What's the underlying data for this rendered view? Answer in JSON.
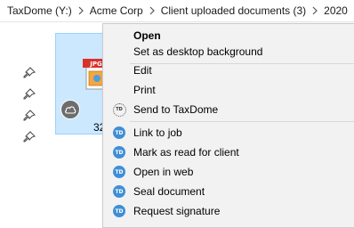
{
  "breadcrumb": {
    "items": [
      "TaxDome (Y:)",
      "Acme Corp",
      "Client uploaded documents (3)",
      "2020"
    ],
    "separator_icon": "chevron-right-icon"
  },
  "left_pane": {
    "pin_icons": [
      "pin-icon",
      "pin-icon",
      "pin-icon",
      "pin-icon"
    ]
  },
  "file": {
    "icon": "jpg-file-icon",
    "icon_label": "JPG",
    "status_icon": "cloud-icon",
    "name_visible": "32"
  },
  "context_menu": {
    "items": [
      {
        "label": "Open",
        "bold": true,
        "icon": ""
      },
      {
        "label": "Set as desktop background",
        "icon": ""
      },
      {
        "label": "Edit",
        "icon": ""
      },
      {
        "label": "Print",
        "icon": ""
      },
      {
        "label": "Send to TaxDome",
        "icon": "taxdome-outline-icon"
      },
      {
        "label": "Link to job",
        "icon": "taxdome-icon"
      },
      {
        "label": "Mark as read for client",
        "icon": "taxdome-icon"
      },
      {
        "label": "Open in web",
        "icon": "taxdome-icon"
      },
      {
        "label": "Seal document",
        "icon": "taxdome-icon"
      },
      {
        "label": "Request signature",
        "icon": "taxdome-icon"
      }
    ],
    "icon_text": "TD"
  },
  "colors": {
    "selection_fill": "#cce8ff",
    "selection_border": "#99d1ff",
    "menu_background": "#f2f2f2",
    "taxdome_blue": "#3f8fd6"
  }
}
